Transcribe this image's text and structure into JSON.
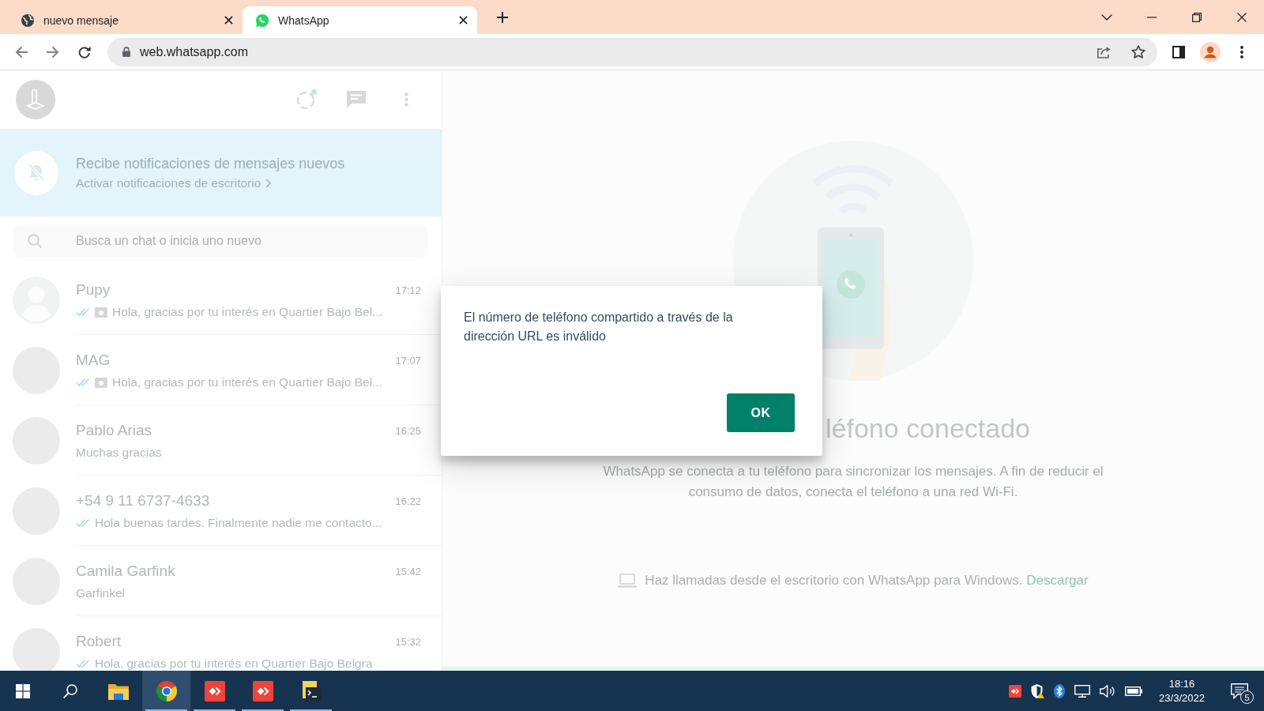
{
  "browser": {
    "tabs": [
      {
        "kind": "globe",
        "title": "nuevo mensaje",
        "selected": false
      },
      {
        "kind": "chat",
        "title": "WhatsApp",
        "selected": true
      }
    ],
    "address": "web.whatsapp.com"
  },
  "sidebar": {
    "banner": {
      "title": "Recibe notificaciones de mensajes nuevos",
      "link": "Activar notificaciones de escritorio"
    },
    "search": {
      "placeholder": "Busca un chat o inicia uno nuevo"
    },
    "chats": [
      {
        "kind": "default",
        "name": "Pupy",
        "time": "17:12",
        "double_tick": true,
        "media": true,
        "preview": "Hola, gracias por tu interés en Quartier Bajo Bel..."
      },
      {
        "kind": "photo",
        "name": "MAG",
        "time": "17:07",
        "double_tick": true,
        "media": true,
        "preview": "Hola, gracias por tu interés en Quartier Bajo Bel..."
      },
      {
        "kind": "photo",
        "name": "Pablo Arias",
        "time": "16:25",
        "double_tick": false,
        "media": false,
        "preview": "Muchas gracias"
      },
      {
        "kind": "photo",
        "name": "+54 9 11 6737-4633",
        "time": "16:22",
        "double_tick": true,
        "media": false,
        "preview": "Hola buenas tardes. Finalmente nadie me contacto..."
      },
      {
        "kind": "photo",
        "name": "Camila Garfink",
        "time": "15:42",
        "double_tick": false,
        "media": false,
        "preview": "Garfinkel"
      },
      {
        "kind": "photo",
        "name": "Robert",
        "time": "15:32",
        "double_tick": true,
        "media": false,
        "preview": "Hola, gracias por tu interés en Quartier Bajo Belgra"
      }
    ]
  },
  "intro": {
    "title": "léfono conectado",
    "description": "WhatsApp se conecta a tu teléfono para sincronizar los mensajes. A fin de reducir el consumo de datos, conecta el teléfono a una red Wi-Fi.",
    "desktop_note": "Haz llamadas desde el escritorio con WhatsApp para Windows.",
    "download_link": "Descargar"
  },
  "dialog": {
    "message": "El número de teléfono compartido a través de la dirección URL es inválido",
    "button": "OK"
  },
  "taskbar": {
    "apps": [
      {
        "kind": "folder",
        "selected": false,
        "running": false
      },
      {
        "kind": "browser",
        "selected": true,
        "running": true
      },
      {
        "kind": "remote",
        "selected": false,
        "running": true
      },
      {
        "kind": "remote",
        "selected": false,
        "running": true
      },
      {
        "kind": "script",
        "selected": false,
        "running": true
      }
    ],
    "time": "18:16",
    "date": "23/3/2022",
    "notifications": "5"
  }
}
